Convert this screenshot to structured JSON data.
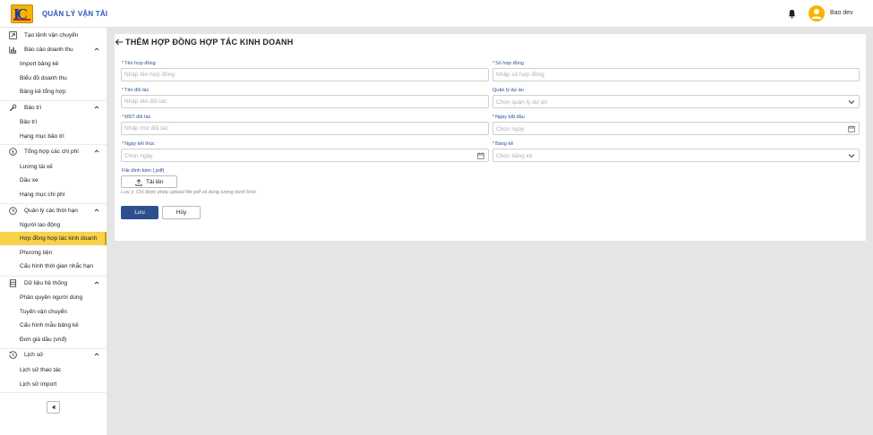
{
  "header": {
    "brand": "QUẢN LÝ VẬN TẢI",
    "user_name": "Bao dev"
  },
  "sidebar": {
    "top_item": "Tạo lệnh vận chuyển",
    "groups": [
      {
        "label": "Báo cáo doanh thu",
        "icon": "bar-chart-icon",
        "items": [
          "Import bảng kê",
          "Biểu đồ doanh thu",
          "Bảng kê tổng hợp"
        ]
      },
      {
        "label": "Bảo trì",
        "icon": "wrench-icon",
        "items": [
          "Bảo trì",
          "Hạng mục bảo trì"
        ]
      },
      {
        "label": "Tổng hợp các chi phí",
        "icon": "dollar-circle-icon",
        "items": [
          "Lương tài xế",
          "Dầu xe",
          "Hạng mục chi phí"
        ]
      },
      {
        "label": "Quản lý các thời hạn",
        "icon": "clock-icon",
        "items": [
          "Người lao động",
          "Hợp đồng hợp tác kinh doanh",
          "Phương tiện",
          "Cấu hình thời gian nhắc hạn"
        ]
      },
      {
        "label": "Dữ liệu hệ thống",
        "icon": "database-icon",
        "items": [
          "Phân quyền người dùng",
          "Tuyến vận chuyển",
          "Cấu hình mẫu bảng kê",
          "Đơn giá dầu (vnđ)"
        ]
      },
      {
        "label": "Lịch sử",
        "icon": "history-icon",
        "items": [
          "Lịch sử thao tác",
          "Lịch sử import"
        ]
      }
    ],
    "active_item": "Hợp đồng hợp tác kinh doanh"
  },
  "page": {
    "title": "THÊM HỢP ĐỒNG HỢP TÁC KINH DOANH"
  },
  "form": {
    "contract_name": {
      "label": "Tên hợp đồng",
      "placeholder": "Nhập tên hợp đồng"
    },
    "contract_number": {
      "label": "Số hợp đồng",
      "placeholder": "Nhập số hợp đồng"
    },
    "partner_name": {
      "label": "Tên đối tác",
      "placeholder": "Nhập tên đối tác"
    },
    "project_manager": {
      "label": "Quản lý dự án",
      "placeholder": "Chọn quản lý dự án"
    },
    "partner_tax_code": {
      "label": "MST đối tác",
      "placeholder": "Nhập mst đối tác"
    },
    "start_date": {
      "label": "Ngày bắt đầu",
      "placeholder": "Chọn ngày"
    },
    "end_date": {
      "label": "Ngày kết thúc",
      "placeholder": "Chọn ngày"
    },
    "statement": {
      "label": "Bảng kê",
      "placeholder": "Chọn bảng kê"
    },
    "attachment": {
      "label": "File đính kèm (.pdf)",
      "button": "Tải lên",
      "note": "Lưu ý: Chỉ được phép upload file pdf và dung lượng dưới 5mb"
    },
    "save_label": "Lưu",
    "cancel_label": "Hủy"
  },
  "colors": {
    "primary": "#2e4f8f",
    "accent": "#f7d24a",
    "label": "#2a4e9c",
    "required": "#d32f2f"
  }
}
